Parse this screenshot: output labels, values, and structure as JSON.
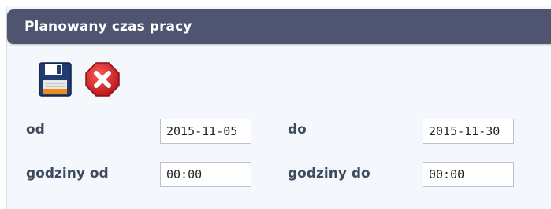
{
  "panel": {
    "title": "Planowany czas pracy"
  },
  "toolbar": {
    "save_icon": "floppy-disk-icon",
    "cancel_icon": "stop-x-icon"
  },
  "form": {
    "from_label": "od",
    "from_value": "2015-11-05",
    "to_label": "do",
    "to_value": "2015-11-30",
    "hours_from_label": "godziny od",
    "hours_from_value": "00:00",
    "hours_to_label": "godziny do",
    "hours_to_value": "00:00"
  },
  "colors": {
    "header_bg": "#4f5470",
    "panel_bg": "#f4f8fc",
    "label_text": "#404a5e",
    "cancel_red": "#d8232a"
  }
}
